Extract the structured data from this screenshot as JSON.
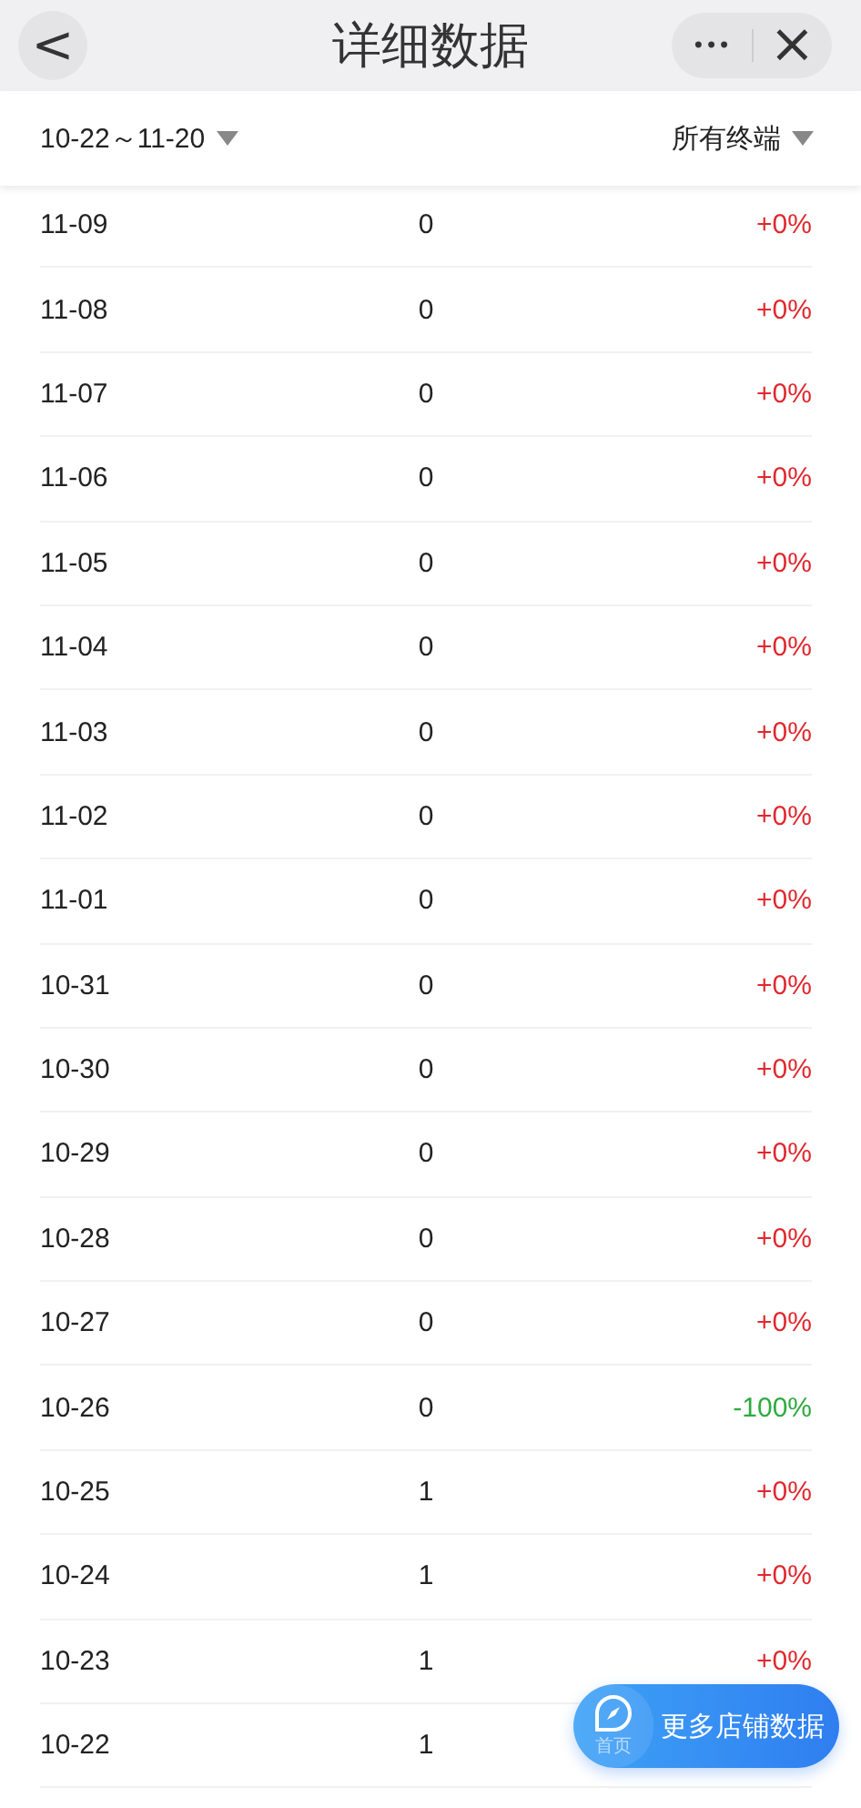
{
  "header": {
    "title": "详细数据",
    "back": "<",
    "more": "•••",
    "close": "×"
  },
  "filters": {
    "date_range": "10-22～11-20",
    "terminal": "所有终端"
  },
  "rows": [
    {
      "date": "11-09",
      "value": "0",
      "change": "+0%",
      "kind": "up"
    },
    {
      "date": "11-08",
      "value": "0",
      "change": "+0%",
      "kind": "up"
    },
    {
      "date": "11-07",
      "value": "0",
      "change": "+0%",
      "kind": "up"
    },
    {
      "date": "11-06",
      "value": "0",
      "change": "+0%",
      "kind": "up"
    },
    {
      "date": "11-05",
      "value": "0",
      "change": "+0%",
      "kind": "up"
    },
    {
      "date": "11-04",
      "value": "0",
      "change": "+0%",
      "kind": "up"
    },
    {
      "date": "11-03",
      "value": "0",
      "change": "+0%",
      "kind": "up"
    },
    {
      "date": "11-02",
      "value": "0",
      "change": "+0%",
      "kind": "up"
    },
    {
      "date": "11-01",
      "value": "0",
      "change": "+0%",
      "kind": "up"
    },
    {
      "date": "10-31",
      "value": "0",
      "change": "+0%",
      "kind": "up"
    },
    {
      "date": "10-30",
      "value": "0",
      "change": "+0%",
      "kind": "up"
    },
    {
      "date": "10-29",
      "value": "0",
      "change": "+0%",
      "kind": "up"
    },
    {
      "date": "10-28",
      "value": "0",
      "change": "+0%",
      "kind": "up"
    },
    {
      "date": "10-27",
      "value": "0",
      "change": "+0%",
      "kind": "up"
    },
    {
      "date": "10-26",
      "value": "0",
      "change": "-100%",
      "kind": "down"
    },
    {
      "date": "10-25",
      "value": "1",
      "change": "+0%",
      "kind": "up"
    },
    {
      "date": "10-24",
      "value": "1",
      "change": "+0%",
      "kind": "up"
    },
    {
      "date": "10-23",
      "value": "1",
      "change": "+0%",
      "kind": "up"
    },
    {
      "date": "10-22",
      "value": "1"
    }
  ],
  "float_button": {
    "icon_label": "首页",
    "label": "更多店铺数据"
  }
}
